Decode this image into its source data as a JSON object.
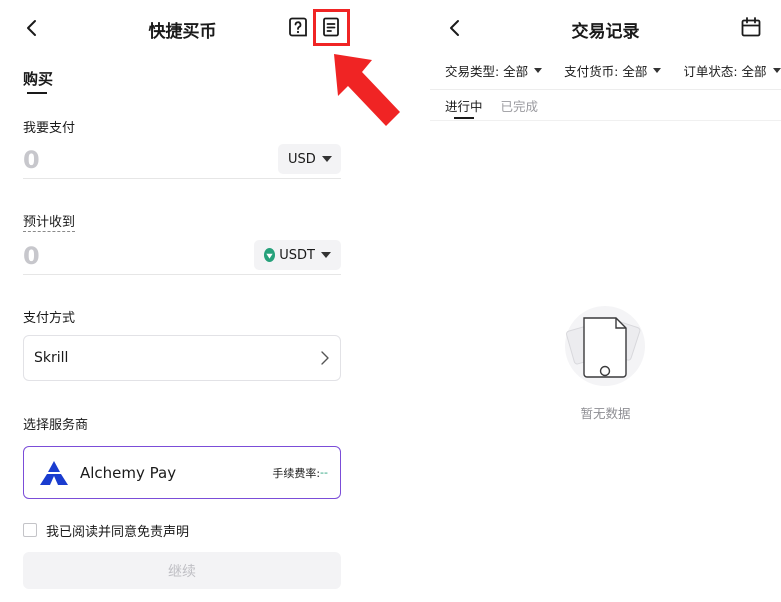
{
  "left": {
    "header": {
      "title": "快捷买币"
    },
    "tab": "购买",
    "pay": {
      "label": "我要支付",
      "amount": "0",
      "currency": "USD"
    },
    "receive": {
      "label": "预计收到",
      "amount": "0",
      "currency": "USDT"
    },
    "payment_method": {
      "label": "支付方式",
      "value": "Skrill"
    },
    "provider": {
      "label": "选择服务商",
      "name": "Alchemy Pay",
      "fee_label": "手续费率:",
      "fee_value": "--"
    },
    "agreement": "我已阅读并同意免责声明",
    "continue_label": "继续"
  },
  "right": {
    "header": {
      "title": "交易记录"
    },
    "filters": [
      {
        "label": "交易类型: 全部"
      },
      {
        "label": "支付货币: 全部"
      },
      {
        "label": "订单状态: 全部"
      }
    ],
    "tabs": [
      {
        "label": "进行中"
      },
      {
        "label": "已完成"
      }
    ],
    "empty_text": "暂无数据"
  },
  "colors": {
    "highlight": "#f02424",
    "provider_border": "#7b4dd8",
    "usdt": "#26a17b",
    "provider_logo": "#1a3ccf"
  },
  "icons": {
    "back": "chevron-left-icon",
    "help": "help-icon",
    "record": "document-icon",
    "calendar": "calendar-icon"
  }
}
